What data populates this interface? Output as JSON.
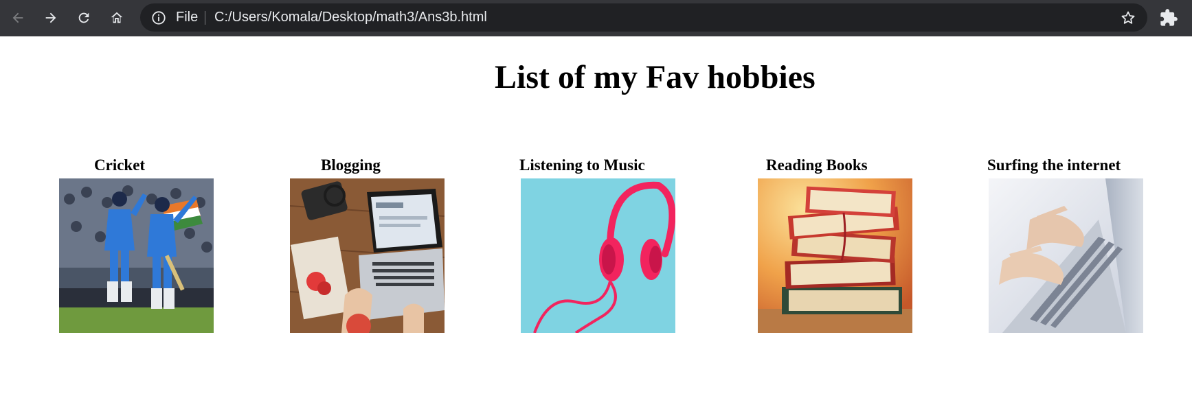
{
  "browser": {
    "file_label": "File",
    "url": "C:/Users/Komala/Desktop/math3/Ans3b.html",
    "icons": [
      "back-icon",
      "forward-icon",
      "reload-icon",
      "home-icon",
      "info-icon",
      "star-icon",
      "extensions-icon"
    ]
  },
  "page": {
    "title": "List of my Fav hobbies",
    "hobbies": [
      {
        "label": "Cricket",
        "image": "cricket-players-image"
      },
      {
        "label": "Blogging",
        "image": "laptop-blog-desk-image"
      },
      {
        "label": "Listening to Music",
        "image": "pink-headphones-image"
      },
      {
        "label": "Reading Books",
        "image": "stacked-books-image"
      },
      {
        "label": "Surfing the internet",
        "image": "hands-typing-laptop-image"
      }
    ]
  },
  "colors": {
    "chrome_bg": "#35363a",
    "omnibox_bg": "#202124",
    "chrome_text": "#e8eaed",
    "page_bg": "#ffffff"
  }
}
